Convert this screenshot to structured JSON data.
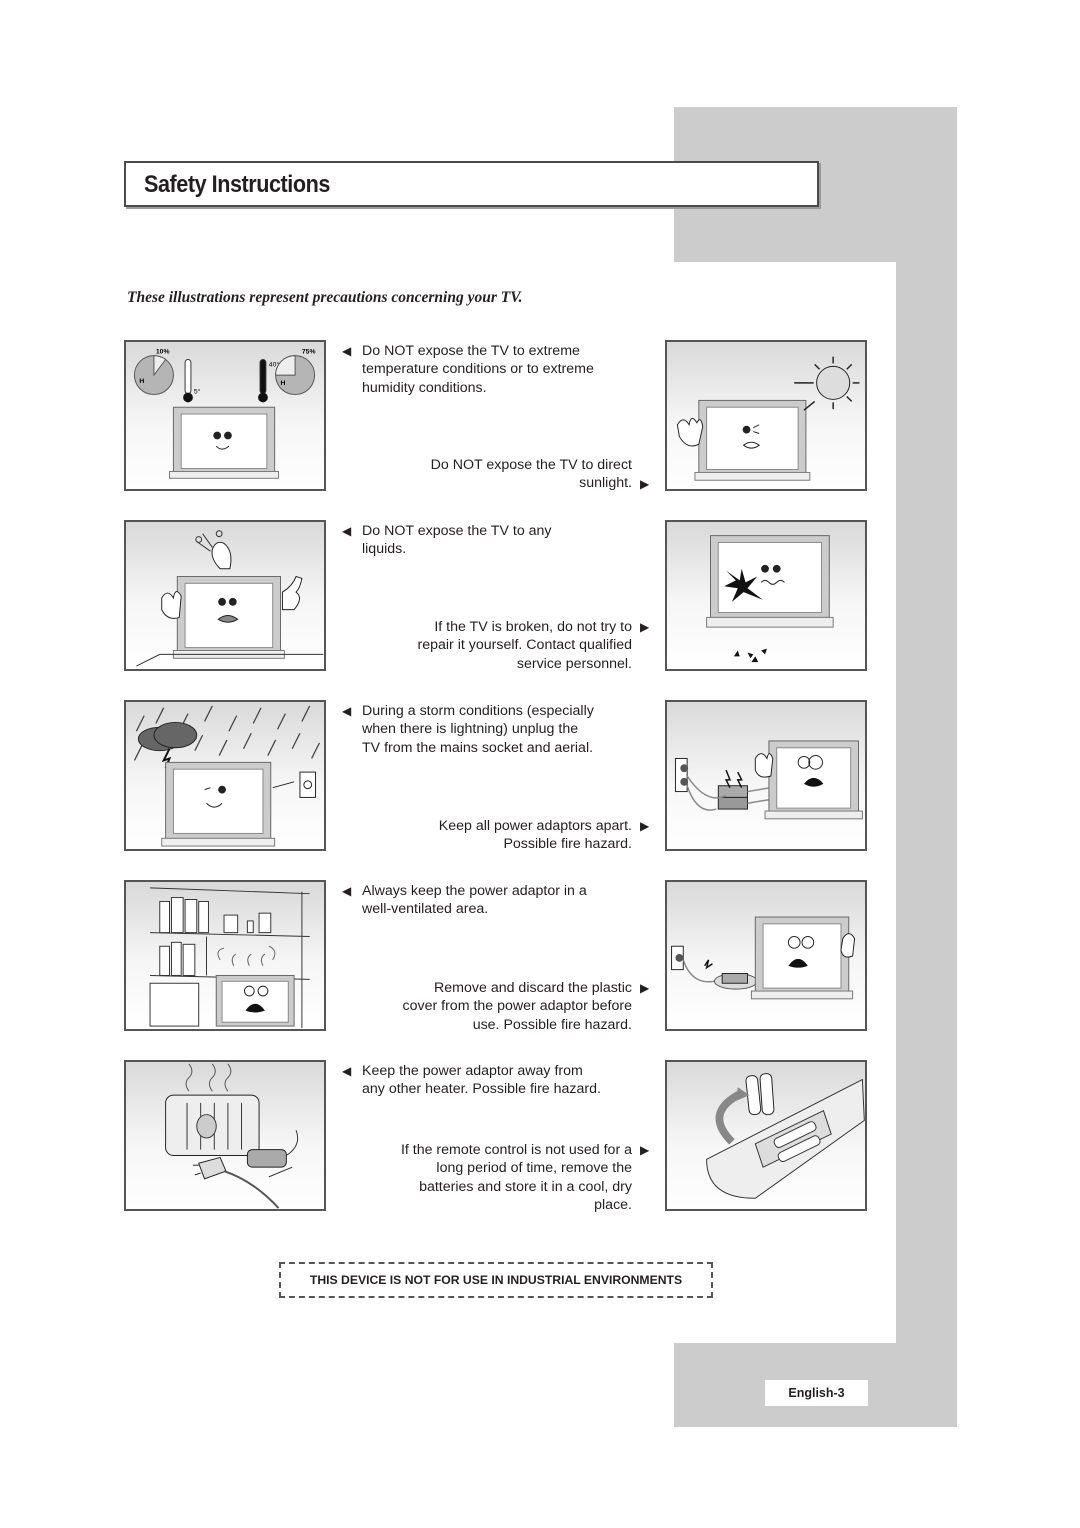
{
  "page": {
    "title": "Safety Instructions",
    "subtitle": "These illustrations represent precautions concerning your TV.",
    "notice": "THIS DEVICE IS NOT FOR USE IN INDUSTRIAL ENVIRONMENTS",
    "page_number": "English-3"
  },
  "rows": [
    {
      "left_text": [
        "Do NOT expose the TV to extreme",
        "temperature conditions or to extreme",
        "humidity conditions."
      ],
      "right_text": [
        "Do NOT expose the TV to direct",
        "sunlight."
      ],
      "left_illustration": "tv-temperature-humidity",
      "left_labels": {
        "humidity_low": "10%",
        "humidity_high": "75%",
        "temp_low": "5°",
        "temp_high": "40°",
        "h": "H"
      },
      "right_illustration": "tv-sunlight"
    },
    {
      "left_text": [
        "Do NOT expose the TV to any",
        "liquids."
      ],
      "right_text": [
        "If the TV is broken, do not try to",
        "repair it yourself. Contact qualified",
        "service personnel."
      ],
      "left_illustration": "tv-liquids-vase",
      "right_illustration": "tv-broken-screen"
    },
    {
      "left_text": [
        "During a storm conditions (especially",
        "when there is lightning) unplug the",
        "TV from the mains socket and aerial."
      ],
      "right_text": [
        "Keep all power adaptors apart.",
        "Possible fire hazard."
      ],
      "left_illustration": "tv-storm-unplug",
      "right_illustration": "tv-stacked-adaptors"
    },
    {
      "left_text": [
        "Always keep the power adaptor in a",
        "well-ventilated area."
      ],
      "right_text": [
        "Remove and discard the plastic",
        "cover from the power adaptor before",
        "use. Possible fire hazard."
      ],
      "left_illustration": "tv-enclosed-shelf",
      "right_illustration": "tv-adaptor-plastic-cover"
    },
    {
      "left_text": [
        "Keep the power adaptor away from",
        "any other heater. Possible fire hazard."
      ],
      "right_text": [
        "If the remote control is not used for a",
        "long period of time, remove the",
        "batteries and store it in a cool, dry",
        "place."
      ],
      "left_illustration": "adaptor-near-heater",
      "right_illustration": "remote-batteries"
    }
  ],
  "icons": {
    "left_arrow": "◀",
    "right_arrow": "▶"
  }
}
